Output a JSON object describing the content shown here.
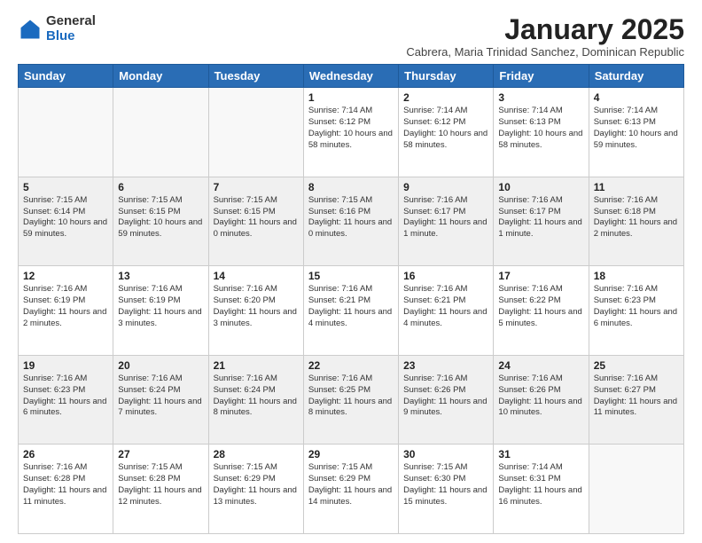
{
  "logo": {
    "general": "General",
    "blue": "Blue"
  },
  "title": "January 2025",
  "subtitle": "Cabrera, Maria Trinidad Sanchez, Dominican Republic",
  "days_of_week": [
    "Sunday",
    "Monday",
    "Tuesday",
    "Wednesday",
    "Thursday",
    "Friday",
    "Saturday"
  ],
  "weeks": [
    [
      {
        "day": "",
        "info": "",
        "empty": true
      },
      {
        "day": "",
        "info": "",
        "empty": true
      },
      {
        "day": "",
        "info": "",
        "empty": true
      },
      {
        "day": "1",
        "info": "Sunrise: 7:14 AM\nSunset: 6:12 PM\nDaylight: 10 hours\nand 58 minutes.",
        "empty": false
      },
      {
        "day": "2",
        "info": "Sunrise: 7:14 AM\nSunset: 6:12 PM\nDaylight: 10 hours\nand 58 minutes.",
        "empty": false
      },
      {
        "day": "3",
        "info": "Sunrise: 7:14 AM\nSunset: 6:13 PM\nDaylight: 10 hours\nand 58 minutes.",
        "empty": false
      },
      {
        "day": "4",
        "info": "Sunrise: 7:14 AM\nSunset: 6:13 PM\nDaylight: 10 hours\nand 59 minutes.",
        "empty": false
      }
    ],
    [
      {
        "day": "5",
        "info": "Sunrise: 7:15 AM\nSunset: 6:14 PM\nDaylight: 10 hours\nand 59 minutes.",
        "empty": false,
        "shaded": true
      },
      {
        "day": "6",
        "info": "Sunrise: 7:15 AM\nSunset: 6:15 PM\nDaylight: 10 hours\nand 59 minutes.",
        "empty": false,
        "shaded": true
      },
      {
        "day": "7",
        "info": "Sunrise: 7:15 AM\nSunset: 6:15 PM\nDaylight: 11 hours\nand 0 minutes.",
        "empty": false,
        "shaded": true
      },
      {
        "day": "8",
        "info": "Sunrise: 7:15 AM\nSunset: 6:16 PM\nDaylight: 11 hours\nand 0 minutes.",
        "empty": false,
        "shaded": true
      },
      {
        "day": "9",
        "info": "Sunrise: 7:16 AM\nSunset: 6:17 PM\nDaylight: 11 hours\nand 1 minute.",
        "empty": false,
        "shaded": true
      },
      {
        "day": "10",
        "info": "Sunrise: 7:16 AM\nSunset: 6:17 PM\nDaylight: 11 hours\nand 1 minute.",
        "empty": false,
        "shaded": true
      },
      {
        "day": "11",
        "info": "Sunrise: 7:16 AM\nSunset: 6:18 PM\nDaylight: 11 hours\nand 2 minutes.",
        "empty": false,
        "shaded": true
      }
    ],
    [
      {
        "day": "12",
        "info": "Sunrise: 7:16 AM\nSunset: 6:19 PM\nDaylight: 11 hours\nand 2 minutes.",
        "empty": false
      },
      {
        "day": "13",
        "info": "Sunrise: 7:16 AM\nSunset: 6:19 PM\nDaylight: 11 hours\nand 3 minutes.",
        "empty": false
      },
      {
        "day": "14",
        "info": "Sunrise: 7:16 AM\nSunset: 6:20 PM\nDaylight: 11 hours\nand 3 minutes.",
        "empty": false
      },
      {
        "day": "15",
        "info": "Sunrise: 7:16 AM\nSunset: 6:21 PM\nDaylight: 11 hours\nand 4 minutes.",
        "empty": false
      },
      {
        "day": "16",
        "info": "Sunrise: 7:16 AM\nSunset: 6:21 PM\nDaylight: 11 hours\nand 4 minutes.",
        "empty": false
      },
      {
        "day": "17",
        "info": "Sunrise: 7:16 AM\nSunset: 6:22 PM\nDaylight: 11 hours\nand 5 minutes.",
        "empty": false
      },
      {
        "day": "18",
        "info": "Sunrise: 7:16 AM\nSunset: 6:23 PM\nDaylight: 11 hours\nand 6 minutes.",
        "empty": false
      }
    ],
    [
      {
        "day": "19",
        "info": "Sunrise: 7:16 AM\nSunset: 6:23 PM\nDaylight: 11 hours\nand 6 minutes.",
        "empty": false,
        "shaded": true
      },
      {
        "day": "20",
        "info": "Sunrise: 7:16 AM\nSunset: 6:24 PM\nDaylight: 11 hours\nand 7 minutes.",
        "empty": false,
        "shaded": true
      },
      {
        "day": "21",
        "info": "Sunrise: 7:16 AM\nSunset: 6:24 PM\nDaylight: 11 hours\nand 8 minutes.",
        "empty": false,
        "shaded": true
      },
      {
        "day": "22",
        "info": "Sunrise: 7:16 AM\nSunset: 6:25 PM\nDaylight: 11 hours\nand 8 minutes.",
        "empty": false,
        "shaded": true
      },
      {
        "day": "23",
        "info": "Sunrise: 7:16 AM\nSunset: 6:26 PM\nDaylight: 11 hours\nand 9 minutes.",
        "empty": false,
        "shaded": true
      },
      {
        "day": "24",
        "info": "Sunrise: 7:16 AM\nSunset: 6:26 PM\nDaylight: 11 hours\nand 10 minutes.",
        "empty": false,
        "shaded": true
      },
      {
        "day": "25",
        "info": "Sunrise: 7:16 AM\nSunset: 6:27 PM\nDaylight: 11 hours\nand 11 minutes.",
        "empty": false,
        "shaded": true
      }
    ],
    [
      {
        "day": "26",
        "info": "Sunrise: 7:16 AM\nSunset: 6:28 PM\nDaylight: 11 hours\nand 11 minutes.",
        "empty": false
      },
      {
        "day": "27",
        "info": "Sunrise: 7:15 AM\nSunset: 6:28 PM\nDaylight: 11 hours\nand 12 minutes.",
        "empty": false
      },
      {
        "day": "28",
        "info": "Sunrise: 7:15 AM\nSunset: 6:29 PM\nDaylight: 11 hours\nand 13 minutes.",
        "empty": false
      },
      {
        "day": "29",
        "info": "Sunrise: 7:15 AM\nSunset: 6:29 PM\nDaylight: 11 hours\nand 14 minutes.",
        "empty": false
      },
      {
        "day": "30",
        "info": "Sunrise: 7:15 AM\nSunset: 6:30 PM\nDaylight: 11 hours\nand 15 minutes.",
        "empty": false
      },
      {
        "day": "31",
        "info": "Sunrise: 7:14 AM\nSunset: 6:31 PM\nDaylight: 11 hours\nand 16 minutes.",
        "empty": false
      },
      {
        "day": "",
        "info": "",
        "empty": true
      }
    ]
  ]
}
